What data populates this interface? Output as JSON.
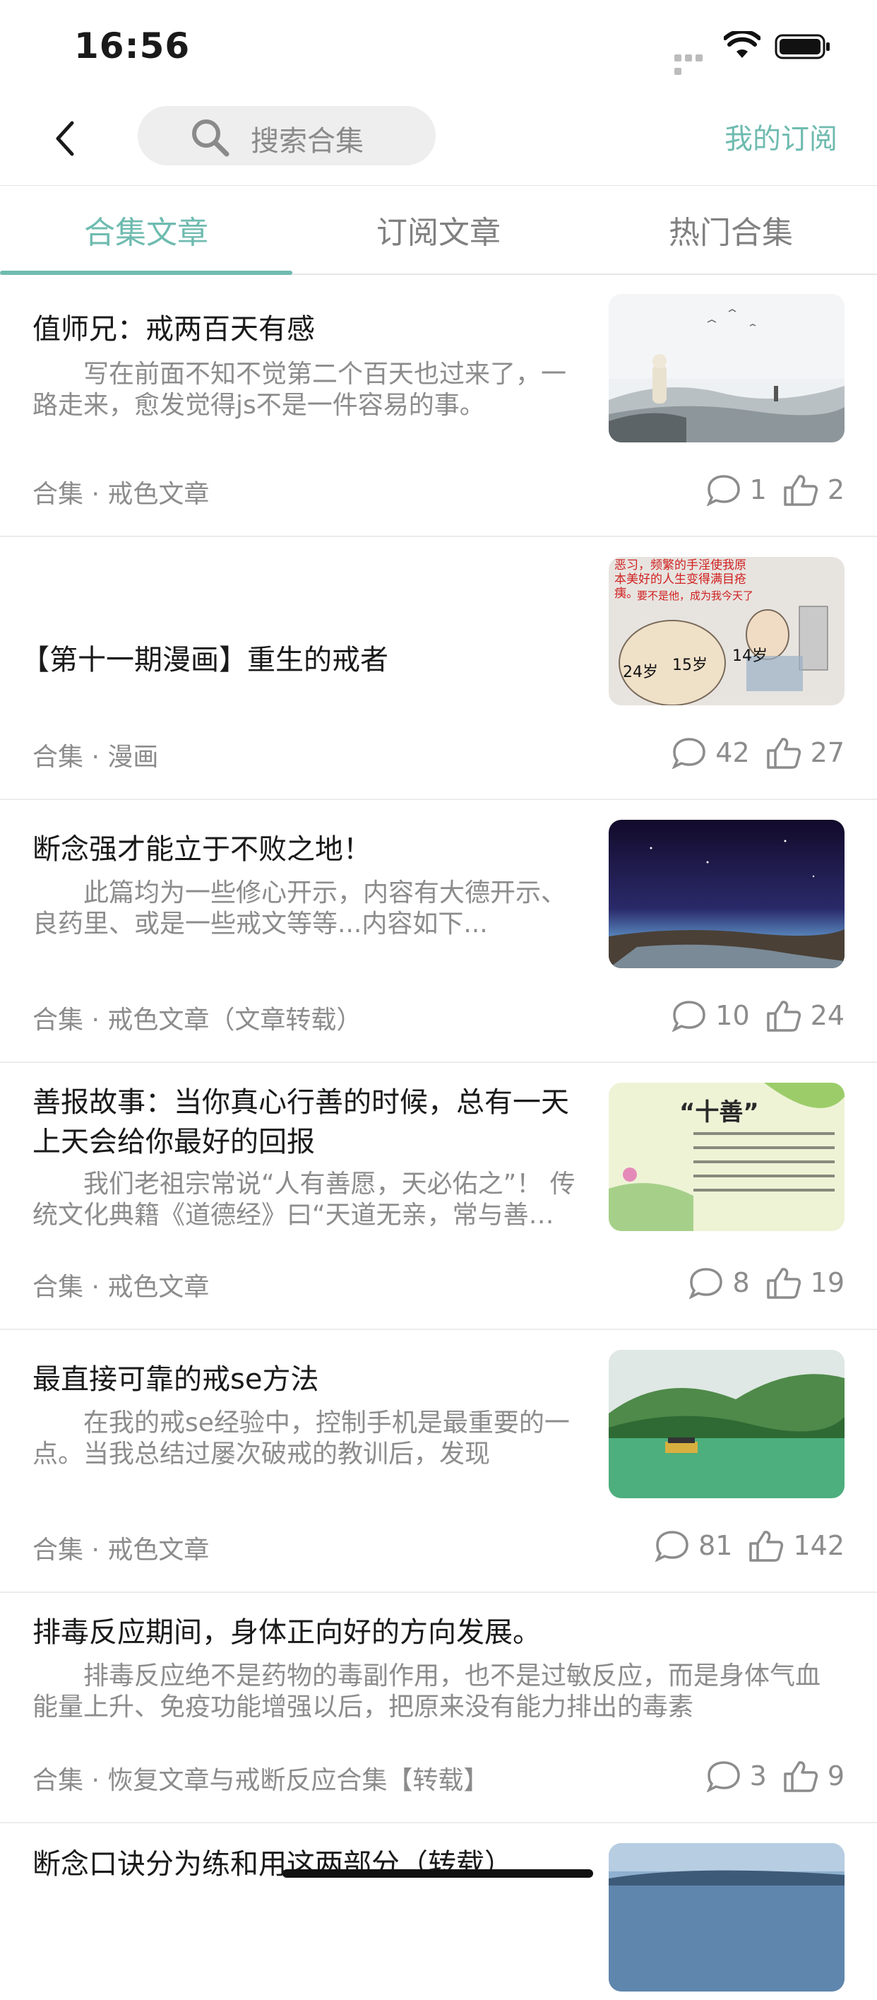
{
  "status_bar": {
    "time": "16:56"
  },
  "nav": {
    "search_placeholder": "搜索合集",
    "my_subscription": "我的订阅"
  },
  "tabs": [
    {
      "label": "合集文章",
      "active": true
    },
    {
      "label": "订阅文章",
      "active": false
    },
    {
      "label": "热门合集",
      "active": false
    }
  ],
  "articles": [
    {
      "title": "值师兄：戒两百天有感",
      "summary": "写在前面不知不觉第二个百天也过来了，一路走来，愈发觉得js不是一件容易的事。",
      "tag": "合集 · 戒色文章",
      "comments": "1",
      "likes": "2",
      "thumb": "ink-painting"
    },
    {
      "title": "【第十一期漫画】重生的戒者",
      "summary": "",
      "tag": "合集 · 漫画",
      "comments": "42",
      "likes": "27",
      "thumb": "comic",
      "thumb_text": {
        "caption": "恶习，频繁的手淫使我原本美好的人生变得满目疮痍。",
        "caption2": "要不是他，成为我今天了",
        "age1": "24岁",
        "age2": "15岁",
        "age3": "14岁"
      }
    },
    {
      "title": "断念强才能立于不败之地！",
      "summary": "此篇均为一些修心开示，内容有大德开示、良药里、或是一些戒文等等...内容如下...",
      "tag": "合集 · 戒色文章（文章转载）",
      "comments": "10",
      "likes": "24",
      "thumb": "night-sky"
    },
    {
      "title": "善报故事：当你真心行善的时候，总有一天上天会给你最好的回报",
      "summary": "我们老祖宗常说“人有善愿，天必佑之”！ 传统文化典籍《道德经》曰“天道无亲，常与善人”。",
      "tag": "合集 · 戒色文章",
      "comments": "8",
      "likes": "19",
      "thumb": "ten-good",
      "thumb_text": {
        "heading": "“十善”"
      }
    },
    {
      "title": "最直接可靠的戒se方法",
      "summary": "在我的戒se经验中，控制手机是最重要的一点。当我总结过屡次破戒的教训后，发现",
      "tag": "合集 · 戒色文章",
      "comments": "81",
      "likes": "142",
      "thumb": "lake"
    },
    {
      "title": "排毒反应期间，身体正向好的方向发展。",
      "summary": "排毒反应绝不是药物的毒副作用，也不是过敏反应，而是身体气血能量上升、免疫功能增强以后，把原来没有能力排出的毒素",
      "tag": "合集 · 恢复文章与戒断反应合集【转载】",
      "comments": "3",
      "likes": "9",
      "thumb": ""
    },
    {
      "title": "断念口诀分为练和用这两部分（转载）",
      "summary": "",
      "tag": "",
      "comments": "",
      "likes": "",
      "thumb": "landscape"
    }
  ],
  "colors": {
    "accent": "#6fbbb0",
    "secondary_text": "#8c8c8c"
  }
}
